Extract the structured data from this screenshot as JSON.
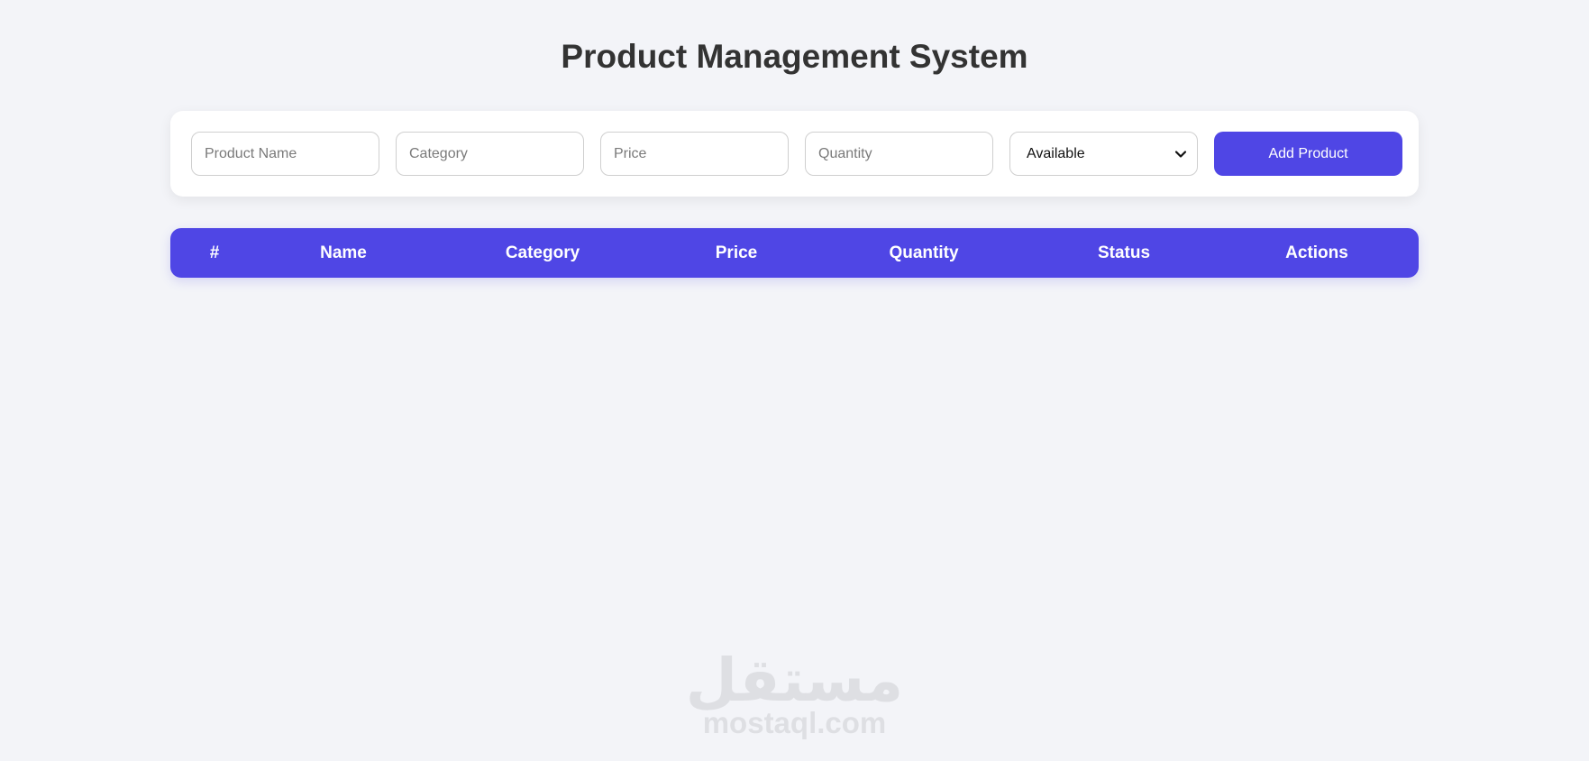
{
  "page": {
    "title": "Product Management System"
  },
  "form": {
    "product_name": {
      "placeholder": "Product Name",
      "value": ""
    },
    "category": {
      "placeholder": "Category",
      "value": ""
    },
    "price": {
      "placeholder": "Price",
      "value": ""
    },
    "quantity": {
      "placeholder": "Quantity",
      "value": ""
    },
    "status_select": {
      "selected": "Available"
    },
    "add_button_label": "Add Product"
  },
  "table": {
    "columns": [
      "#",
      "Name",
      "Category",
      "Price",
      "Quantity",
      "Status",
      "Actions"
    ],
    "rows": []
  },
  "watermark": {
    "arabic": "مستقل",
    "latin": "mostaql.com"
  },
  "colors": {
    "accent": "#4f46e5",
    "background": "#f3f4f8",
    "card": "#ffffff",
    "title": "#333333"
  },
  "icons": {
    "select_arrow": "chevron-down-icon"
  }
}
